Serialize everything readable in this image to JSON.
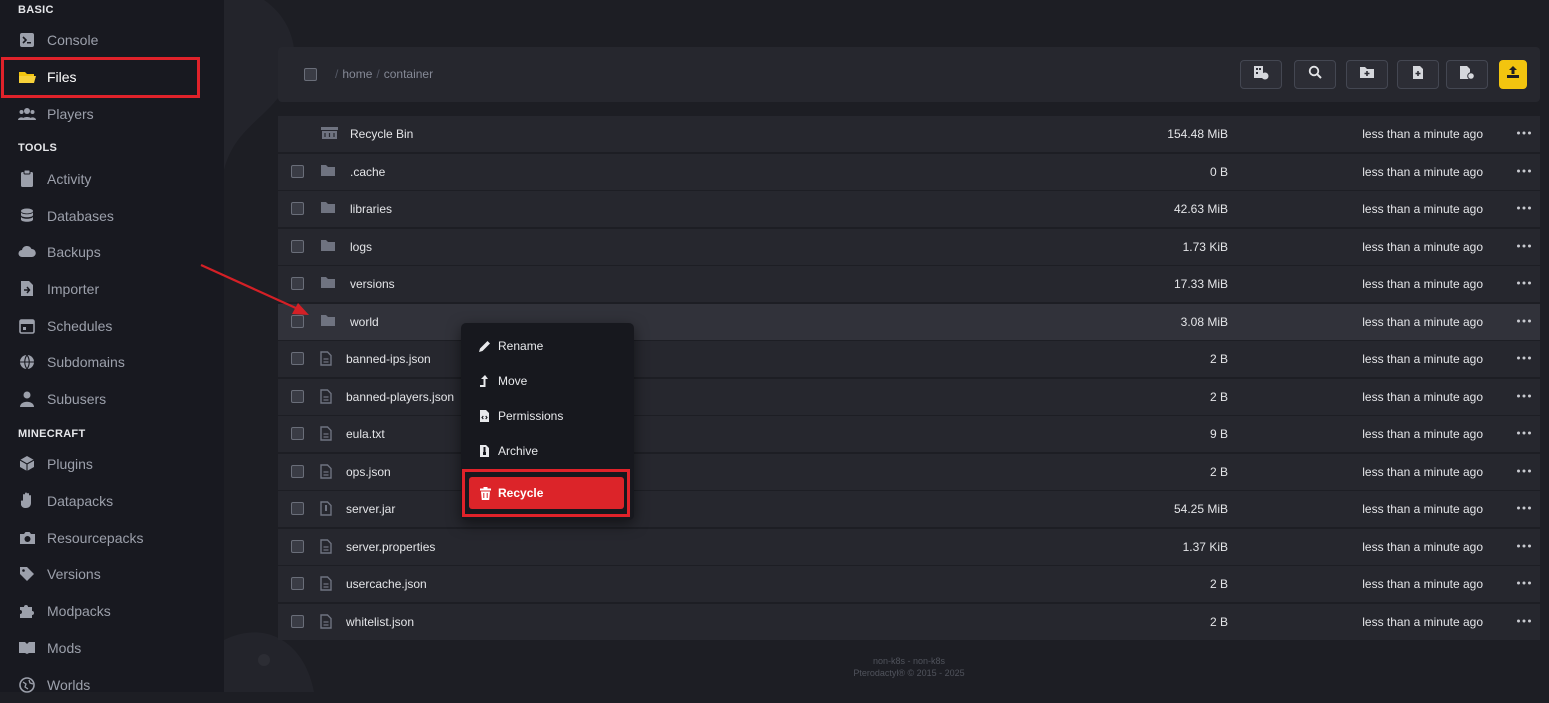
{
  "sidebar": {
    "sections": {
      "basic": "BASIC",
      "tools": "TOOLS",
      "minecraft": "MINECRAFT"
    },
    "items": [
      {
        "label": "Console",
        "icon": "terminal-icon"
      },
      {
        "label": "Files",
        "icon": "folder-open-icon",
        "active": true
      },
      {
        "label": "Players",
        "icon": "users-icon"
      },
      {
        "label": "Activity",
        "icon": "clipboard-icon"
      },
      {
        "label": "Databases",
        "icon": "database-icon"
      },
      {
        "label": "Backups",
        "icon": "cloud-icon"
      },
      {
        "label": "Importer",
        "icon": "file-import-icon"
      },
      {
        "label": "Schedules",
        "icon": "calendar-icon"
      },
      {
        "label": "Subdomains",
        "icon": "globe-icon"
      },
      {
        "label": "Subusers",
        "icon": "user-icon"
      },
      {
        "label": "Plugins",
        "icon": "cube-icon"
      },
      {
        "label": "Datapacks",
        "icon": "hand-icon"
      },
      {
        "label": "Resourcepacks",
        "icon": "camera-icon"
      },
      {
        "label": "Versions",
        "icon": "tag-icon"
      },
      {
        "label": "Modpacks",
        "icon": "puzzle-icon"
      },
      {
        "label": "Mods",
        "icon": "book-icon"
      },
      {
        "label": "Worlds",
        "icon": "globe-icon"
      }
    ]
  },
  "breadcrumb": {
    "parts": [
      "home",
      "container"
    ]
  },
  "toolbar": {
    "buttons": [
      "server-folder-icon",
      "search-icon",
      "new-folder-icon",
      "new-file-icon",
      "file-settings-icon",
      "upload-icon"
    ],
    "accent": "#f2c40f"
  },
  "files": [
    {
      "name": "Recycle Bin",
      "size": "154.48 MiB",
      "modified": "less than a minute ago",
      "type": "bin"
    },
    {
      "name": ".cache",
      "size": "0 B",
      "modified": "less than a minute ago",
      "type": "folder"
    },
    {
      "name": "libraries",
      "size": "42.63 MiB",
      "modified": "less than a minute ago",
      "type": "folder"
    },
    {
      "name": "logs",
      "size": "1.73 KiB",
      "modified": "less than a minute ago",
      "type": "folder"
    },
    {
      "name": "versions",
      "size": "17.33 MiB",
      "modified": "less than a minute ago",
      "type": "folder"
    },
    {
      "name": "world",
      "size": "3.08 MiB",
      "modified": "less than a minute ago",
      "type": "folder",
      "hover": true
    },
    {
      "name": "banned-ips.json",
      "size": "2 B",
      "modified": "less than a minute ago",
      "type": "file"
    },
    {
      "name": "banned-players.json",
      "size": "2 B",
      "modified": "less than a minute ago",
      "type": "file"
    },
    {
      "name": "eula.txt",
      "size": "9 B",
      "modified": "less than a minute ago",
      "type": "file"
    },
    {
      "name": "ops.json",
      "size": "2 B",
      "modified": "less than a minute ago",
      "type": "file"
    },
    {
      "name": "server.jar",
      "size": "54.25 MiB",
      "modified": "less than a minute ago",
      "type": "file"
    },
    {
      "name": "server.properties",
      "size": "1.37 KiB",
      "modified": "less than a minute ago",
      "type": "file"
    },
    {
      "name": "usercache.json",
      "size": "2 B",
      "modified": "less than a minute ago",
      "type": "file"
    },
    {
      "name": "whitelist.json",
      "size": "2 B",
      "modified": "less than a minute ago",
      "type": "file"
    }
  ],
  "context_menu": {
    "rename": "Rename",
    "move": "Move",
    "permissions": "Permissions",
    "archive": "Archive",
    "recycle": "Recycle",
    "danger_color": "#dc2429"
  },
  "footer": {
    "line1": "non-k8s - non-k8s",
    "line2": "Pterodactyl® © 2015 - 2025"
  },
  "annotation_color": "#e0222a"
}
